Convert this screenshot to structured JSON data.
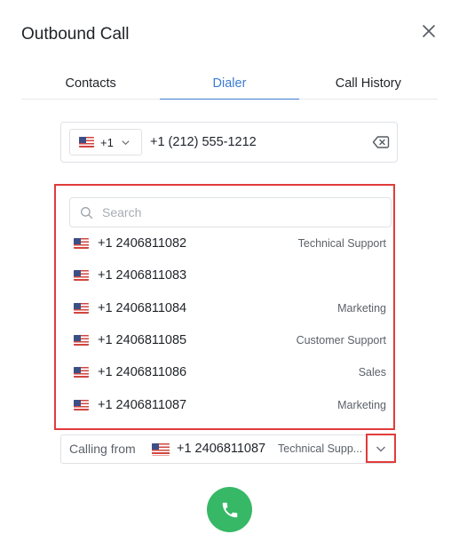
{
  "dialog": {
    "title": "Outbound Call"
  },
  "tabs": [
    {
      "label": "Contacts",
      "active": false
    },
    {
      "label": "Dialer",
      "active": true
    },
    {
      "label": "Call History",
      "active": false
    }
  ],
  "phone_input": {
    "country_code": "+1",
    "country_flag": "us-flag-icon",
    "value": "+1 (212) 555-1212"
  },
  "caller_id_dropdown": {
    "search_placeholder": "Search",
    "options": [
      {
        "number": "+1 2406811082",
        "label": "Technical Support"
      },
      {
        "number": "+1 2406811083",
        "label": ""
      },
      {
        "number": "+1 2406811084",
        "label": "Marketing"
      },
      {
        "number": "+1 2406811085",
        "label": "Customer Support"
      },
      {
        "number": "+1 2406811086",
        "label": "Sales"
      },
      {
        "number": "+1 2406811087",
        "label": "Marketing"
      }
    ]
  },
  "calling_from": {
    "label": "Calling from",
    "number": "+1 2406811087",
    "department": "Technical Supp..."
  },
  "colors": {
    "accent": "#3b7bd4",
    "highlight": "#e23b3b",
    "call_button": "#36b866"
  }
}
